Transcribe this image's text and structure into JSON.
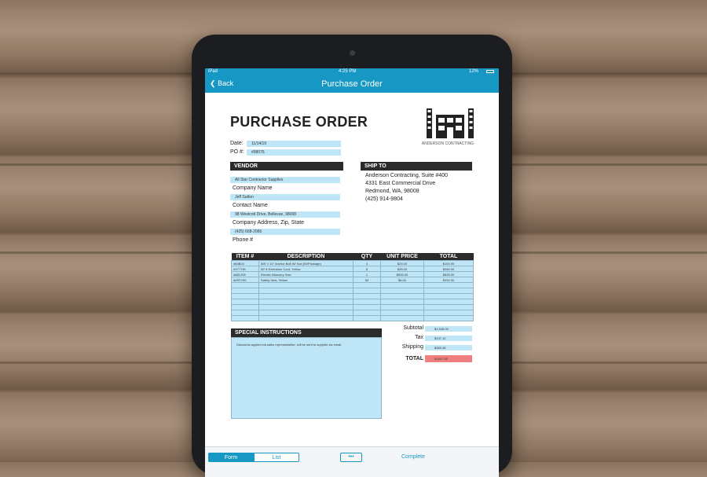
{
  "status_bar": {
    "device": "iPad",
    "time": "4:25 PM",
    "battery": "12%"
  },
  "nav": {
    "back_label": "Back",
    "title": "Purchase Order"
  },
  "document": {
    "heading": "PURCHASE ORDER",
    "date_label": "Date:",
    "date_value": "11/14/19",
    "po_label": "PO #:",
    "po_value": "#98076",
    "company_logo_text": "ANDERSON CONTRACTING",
    "vendor": {
      "header": "VENDOR",
      "company_value": "All Star Contractor Supplies",
      "company_label": "Company Name",
      "contact_value": "Jeff Sutton",
      "contact_label": "Contact Name",
      "address_value": "98 Westcott Drive, Bellevue, 98008",
      "address_label": "Company Address, Zip, State",
      "phone_value": "(425) 668-2056",
      "phone_label": "Phone #"
    },
    "ship_to": {
      "header": "SHIP TO",
      "line1": "Anderson Contracting, Suite #400",
      "line2": "4331 East Commercial Drive",
      "line3": "Redmond, WA, 98008",
      "line4": "(425) 914-9804"
    },
    "items_table": {
      "headers": [
        "ITEM #",
        "DESCRIPTION",
        "QTY",
        "UNIT PRICE",
        "TOTAL"
      ],
      "rows": [
        [
          "#84B24",
          "5/8\" x 10\" Anchor Bolt W/ Nut (50/Package)",
          "4",
          "$25.00",
          "$100.00"
        ],
        [
          "#X77761",
          "50' ft Extension Cord, Yellow",
          "8",
          "$35.00",
          "$280.00"
        ],
        [
          "#881208",
          "Electric Masonry Saw",
          "1",
          "$835.00",
          "$835.00"
        ],
        [
          "#99TC90",
          "Safety Vest, Yellow",
          "50",
          "$6.00",
          "$330.00"
        ],
        [
          "",
          "",
          "",
          "",
          ""
        ],
        [
          "",
          "",
          "",
          "",
          ""
        ],
        [
          "",
          "",
          "",
          "",
          ""
        ],
        [
          "",
          "",
          "",
          "",
          ""
        ],
        [
          "",
          "",
          "",
          "",
          ""
        ],
        [
          "",
          "",
          "",
          "",
          ""
        ],
        [
          "",
          "",
          "",
          "",
          ""
        ]
      ]
    },
    "special_instructions": {
      "header": "SPECIAL INSTRUCTIONS",
      "text": "Discounts applied via sales representative, will be sent to supplier via email."
    },
    "totals": {
      "subtotal_label": "Subtotal",
      "subtotal_value": "$1,545.00",
      "tax_label": "Tax",
      "tax_value": "$137.12",
      "shipping_label": "Shipping",
      "shipping_value": "$365.46",
      "total_label": "TOTAL",
      "total_value": "$1997.58"
    }
  },
  "tab_bar": {
    "form_label": "Form",
    "list_label": "List",
    "more_label": "•••",
    "complete_label": "Complete"
  },
  "colors": {
    "accent": "#1798c4",
    "field_fill": "#bfe6f7",
    "section_header": "#2b2b2b",
    "total_highlight": "#f08080"
  }
}
